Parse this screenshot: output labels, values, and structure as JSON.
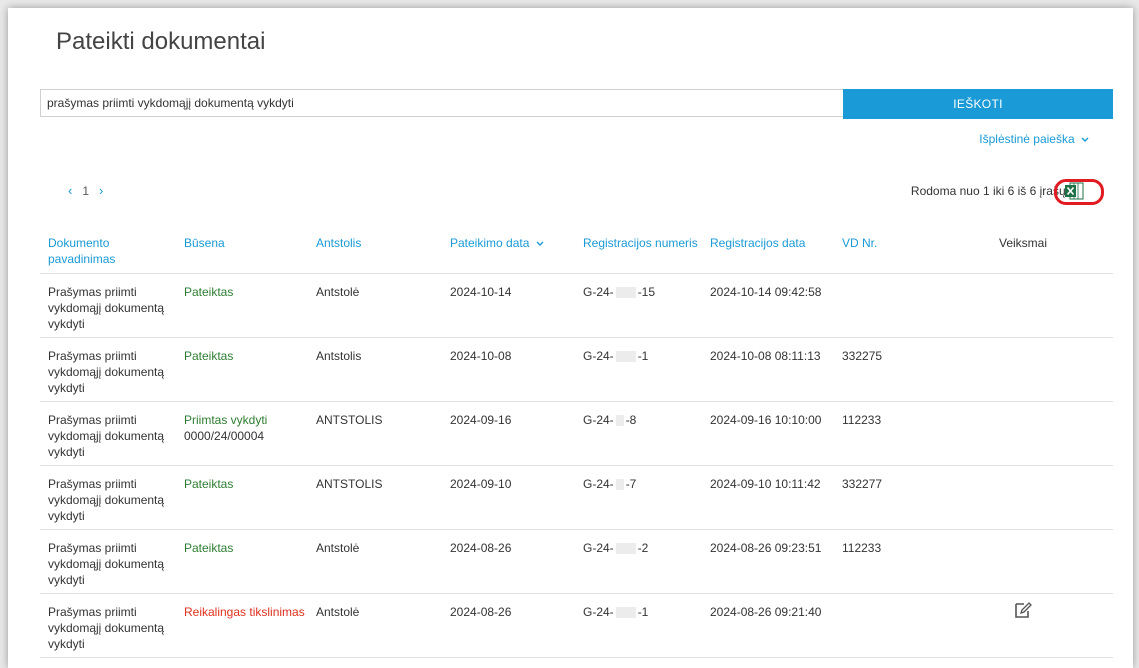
{
  "page": {
    "title": "Pateikti dokumentai"
  },
  "search": {
    "value": "prašymas priimti vykdomąjį dokumentą vykdyti",
    "button_label": "IEŠKOTI",
    "advanced_label": "Išplėstinė paieška"
  },
  "pagination": {
    "prev": "‹",
    "page": "1",
    "next": "›"
  },
  "records_info": "Rodoma nuo 1 iki 6 iš 6 įrašų.",
  "columns": {
    "name": "Dokumento pavadinimas",
    "status": "Būsena",
    "bailiff": "Antstolis",
    "submit_date": "Pateikimo data",
    "reg_number": "Registracijos numeris",
    "reg_date": "Registracijos data",
    "vd": "VD Nr.",
    "actions": "Veiksmai"
  },
  "rows": [
    {
      "name": "Prašymas priimti vykdomąjį dokumentą vykdyti",
      "status": "Pateiktas",
      "status_line2": "",
      "status_color": "#2e7d32",
      "bailiff": "Antstolė",
      "submit_date": "2024-10-14",
      "reg_prefix": "G-24-",
      "reg_suffix": "-15",
      "reg_date": "2024-10-14 09:42:58",
      "vd": "",
      "action": ""
    },
    {
      "name": "Prašymas priimti vykdomąjį dokumentą vykdyti",
      "status": "Pateiktas",
      "status_line2": "",
      "status_color": "#2e7d32",
      "bailiff": "Antstolis",
      "submit_date": "2024-10-08",
      "reg_prefix": "G-24-",
      "reg_suffix": "-1",
      "reg_date": "2024-10-08 08:11:13",
      "vd": "332275",
      "action": ""
    },
    {
      "name": "Prašymas priimti vykdomąjį dokumentą vykdyti",
      "status": "Priimtas vykdyti",
      "status_line2": "0000/24/00004",
      "status_color": "#2e7d32",
      "bailiff": "ANTSTOLIS",
      "submit_date": "2024-09-16",
      "reg_prefix": "G-24-",
      "reg_suffix": "-8",
      "reg_date": "2024-09-16 10:10:00",
      "vd": "112233",
      "action": ""
    },
    {
      "name": "Prašymas priimti vykdomąjį dokumentą vykdyti",
      "status": "Pateiktas",
      "status_line2": "",
      "status_color": "#2e7d32",
      "bailiff": "ANTSTOLIS",
      "submit_date": "2024-09-10",
      "reg_prefix": "G-24-",
      "reg_suffix": "-7",
      "reg_date": "2024-09-10 10:11:42",
      "vd": "332277",
      "action": ""
    },
    {
      "name": "Prašymas priimti vykdomąjį dokumentą vykdyti",
      "status": "Pateiktas",
      "status_line2": "",
      "status_color": "#2e7d32",
      "bailiff": "Antstolė",
      "submit_date": "2024-08-26",
      "reg_prefix": "G-24-",
      "reg_suffix": "-2",
      "reg_date": "2024-08-26 09:23:51",
      "vd": "112233",
      "action": ""
    },
    {
      "name": "Prašymas priimti vykdomąjį dokumentą vykdyti",
      "status": "Reikalingas tikslinimas",
      "status_line2": "",
      "status_color": "#e0301e",
      "bailiff": "Antstolė",
      "submit_date": "2024-08-26",
      "reg_prefix": "G-24-",
      "reg_suffix": "-1",
      "reg_date": "2024-08-26 09:21:40",
      "vd": "",
      "action": "edit-icon"
    }
  ],
  "colors": {
    "accent": "#1a9ad6",
    "highlight": "#e01b22",
    "excel": "#1e7145"
  }
}
